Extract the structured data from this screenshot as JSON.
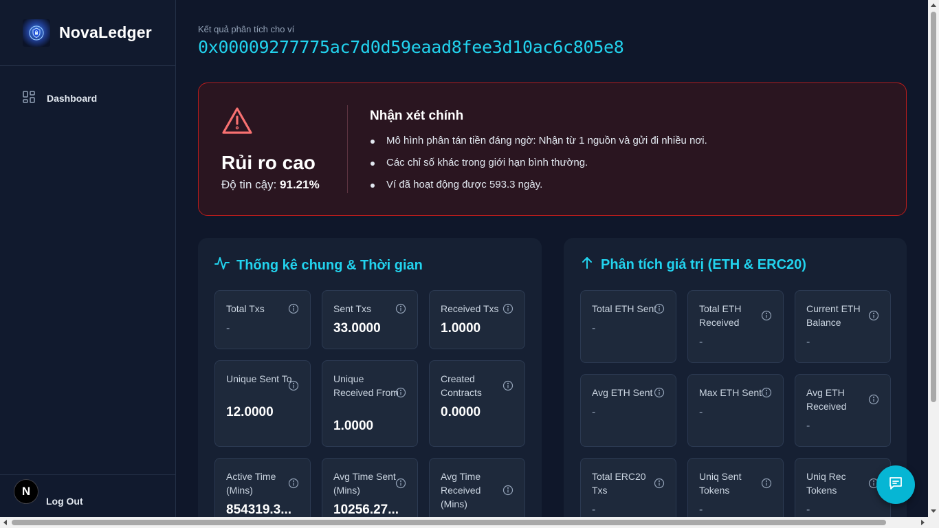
{
  "app": {
    "name": "NovaLedger"
  },
  "sidebar": {
    "items": [
      {
        "label": "Dashboard",
        "icon": "dashboard-grid-icon"
      }
    ],
    "logout_label": "Log Out",
    "badge_letter": "N"
  },
  "wallet": {
    "caption": "Kết quả phân tích cho ví",
    "address": "0x00009277775ac7d0d59eaad8fee3d10ac6c805e8"
  },
  "risk": {
    "level": "Rủi ro cao",
    "confidence_label": "Độ tin cậy:",
    "confidence_value": "91.21%",
    "heading": "Nhận xét chính",
    "points": [
      "Mô hình phân tán tiền đáng ngờ: Nhận từ 1 nguồn và gửi đi nhiều nơi.",
      "Các chỉ số khác trong giới hạn bình thường.",
      "Ví đã hoạt động được 593.3 ngày."
    ],
    "accent_color": "#f87171"
  },
  "general_stats": {
    "title": "Thống kê chung & Thời gian",
    "metrics": [
      {
        "label": "Total Txs",
        "value": "-"
      },
      {
        "label": "Sent Txs",
        "value": "33.0000"
      },
      {
        "label": "Received Txs",
        "value": "1.0000"
      },
      {
        "label": "Unique Sent To",
        "value": "12.0000"
      },
      {
        "label": "Unique Received From",
        "value": "1.0000"
      },
      {
        "label": "Created Contracts",
        "value": "0.0000"
      },
      {
        "label": "Active Time (Mins)",
        "value": "854319.3..."
      },
      {
        "label": "Avg Time Sent (Mins)",
        "value": "10256.27..."
      },
      {
        "label": "Avg Time Received (Mins)",
        "value": ""
      }
    ]
  },
  "value_analysis": {
    "title": "Phân tích giá trị (ETH & ERC20)",
    "metrics": [
      {
        "label": "Total ETH Sent",
        "value": "-"
      },
      {
        "label": "Total ETH Received",
        "value": "-"
      },
      {
        "label": "Current ETH Balance",
        "value": "-"
      },
      {
        "label": "Avg ETH Sent",
        "value": "-"
      },
      {
        "label": "Max ETH Sent",
        "value": "-"
      },
      {
        "label": "Avg ETH Received",
        "value": "-"
      },
      {
        "label": "Total ERC20 Txs",
        "value": "-"
      },
      {
        "label": "Uniq Sent Tokens",
        "value": "-"
      },
      {
        "label": "Uniq Rec Tokens",
        "value": "-"
      }
    ]
  },
  "colors": {
    "accent": "#22d3ee",
    "danger_border": "#b91c1c",
    "background": "#0f172a"
  }
}
